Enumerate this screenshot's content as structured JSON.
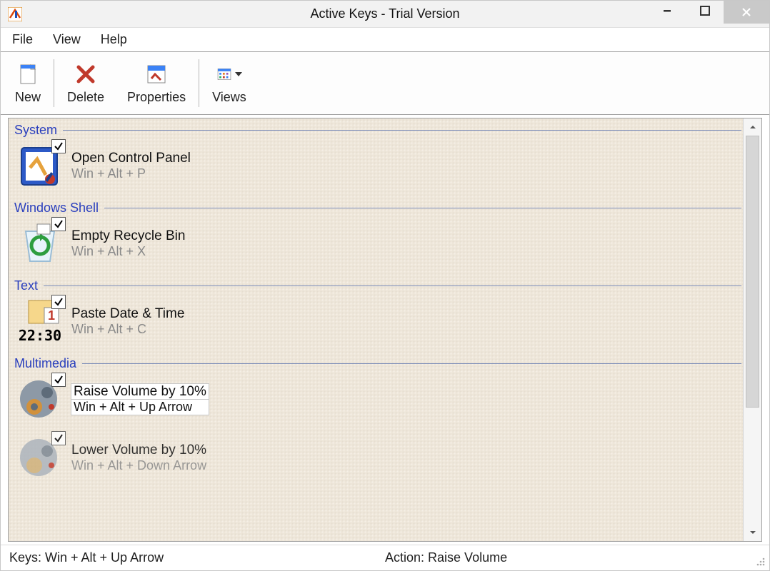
{
  "window": {
    "title": "Active Keys - Trial Version"
  },
  "menu": {
    "items": [
      "File",
      "View",
      "Help"
    ]
  },
  "toolbar": {
    "new": "New",
    "delete": "Delete",
    "properties": "Properties",
    "views": "Views"
  },
  "groups": [
    {
      "name": "System",
      "items": [
        {
          "title": "Open Control Panel",
          "keys": "Win + Alt + P",
          "icon": "control-panel",
          "checked": true,
          "selected": false
        }
      ]
    },
    {
      "name": "Windows Shell",
      "items": [
        {
          "title": "Empty Recycle Bin",
          "keys": "Win + Alt + X",
          "icon": "recycle-bin",
          "checked": true,
          "selected": false
        }
      ]
    },
    {
      "name": "Text",
      "items": [
        {
          "title": "Paste Date & Time",
          "keys": "Win + Alt + C",
          "icon": "date-time",
          "checked": true,
          "selected": false
        }
      ]
    },
    {
      "name": "Multimedia",
      "items": [
        {
          "title": "Raise Volume by 10%",
          "keys": "Win + Alt + Up Arrow",
          "icon": "speaker-up",
          "checked": true,
          "selected": true
        },
        {
          "title": "Lower Volume by 10%",
          "keys": "Win + Alt + Down Arrow",
          "icon": "speaker-down",
          "checked": true,
          "selected": false
        }
      ]
    }
  ],
  "status": {
    "keys_label": "Keys: Win + Alt + Up Arrow",
    "action_label": "Action: Raise Volume"
  }
}
